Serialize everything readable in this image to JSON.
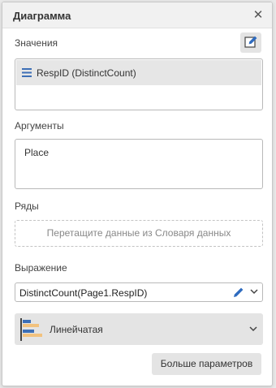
{
  "dialog": {
    "title": "Диаграмма"
  },
  "values": {
    "label": "Значения",
    "items": [
      {
        "label": "RespID (DistinctCount)"
      }
    ]
  },
  "arguments": {
    "label": "Аргументы",
    "items": [
      {
        "label": "Place"
      }
    ]
  },
  "series": {
    "label": "Ряды",
    "dropzone_text": "Перетащите данные из Словаря данных"
  },
  "expression": {
    "label": "Выражение",
    "value": "DistinctCount(Page1.RespID)"
  },
  "chart_type": {
    "selected": "Линейчатая"
  },
  "more_button": {
    "label": "Больше параметров"
  },
  "colors": {
    "accent": "#2e6bbf",
    "bar_orange": "#f2c27e",
    "bar_blue": "#3d6fb6"
  },
  "icons": [
    "close-icon",
    "edit-icon",
    "field-lines-icon",
    "pencil-icon",
    "chevron-down-icon",
    "bar-chart-icon"
  ]
}
